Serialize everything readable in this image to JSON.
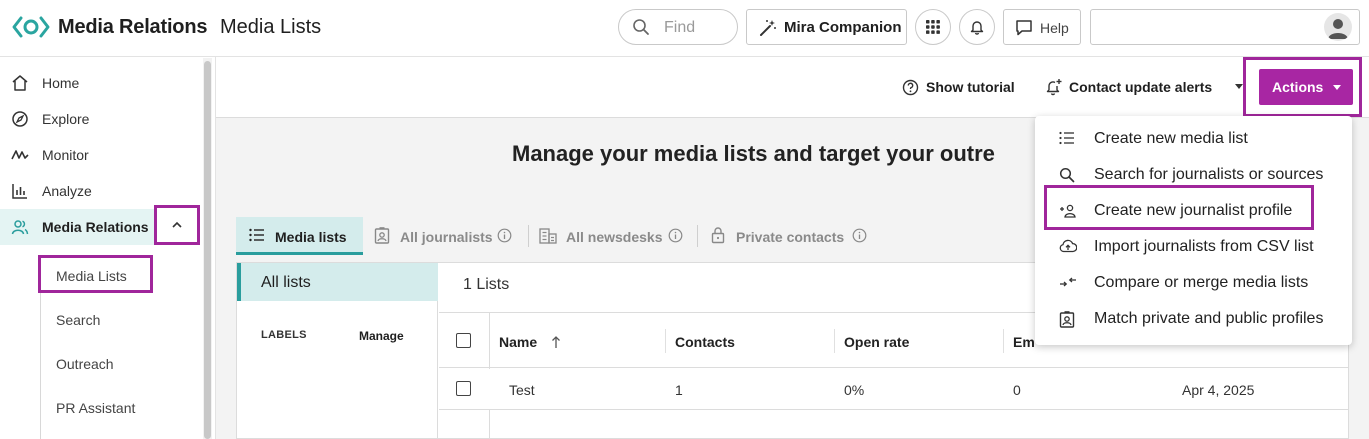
{
  "header": {
    "brand": "Media Relations",
    "page_title": "Media Lists",
    "find_placeholder": "Find",
    "mira_label": "Mira Companion",
    "help_label": "Help"
  },
  "sidebar": {
    "items": [
      {
        "label": "Home",
        "icon": "home-icon"
      },
      {
        "label": "Explore",
        "icon": "compass-icon"
      },
      {
        "label": "Monitor",
        "icon": "monitor-wave-icon"
      },
      {
        "label": "Analyze",
        "icon": "bar-chart-icon"
      },
      {
        "label": "Media Relations",
        "icon": "people-icon",
        "active": true
      }
    ],
    "sub_items": [
      "Media Lists",
      "Search",
      "Outreach",
      "PR Assistant"
    ]
  },
  "toolbar": {
    "show_tutorial": "Show tutorial",
    "contact_alerts": "Contact update alerts",
    "actions": "Actions"
  },
  "main": {
    "headline": "Manage your media lists and target your outre",
    "tabs": [
      {
        "label": "Media lists",
        "active": true
      },
      {
        "label": "All journalists"
      },
      {
        "label": "All newsdesks"
      },
      {
        "label": "Private contacts"
      }
    ],
    "all_lists": "All lists",
    "labels_heading": "LABELS",
    "manage": "Manage",
    "count": "1 Lists",
    "columns": [
      "Name",
      "Contacts",
      "Open rate",
      "Em"
    ],
    "rows": [
      {
        "name": "Test",
        "contacts": "1",
        "open_rate": "0%",
        "em": "0",
        "date": "Apr 4, 2025"
      }
    ]
  },
  "dropdown": {
    "items": [
      {
        "label": "Create new media list",
        "icon": "list-icon"
      },
      {
        "label": "Search for journalists or sources",
        "icon": "search-icon"
      },
      {
        "label": "Create new journalist profile",
        "icon": "add-person-icon"
      },
      {
        "label": "Import journalists from CSV list",
        "icon": "cloud-upload-icon"
      },
      {
        "label": "Compare or merge media lists",
        "icon": "merge-arrows-icon"
      },
      {
        "label": "Match private and public profiles",
        "icon": "profile-card-icon"
      }
    ]
  },
  "colors": {
    "accent_purple": "#a826a3",
    "highlight_border": "#a0269b",
    "teal": "#2a9d9d",
    "teal_light": "#d4ecec"
  }
}
